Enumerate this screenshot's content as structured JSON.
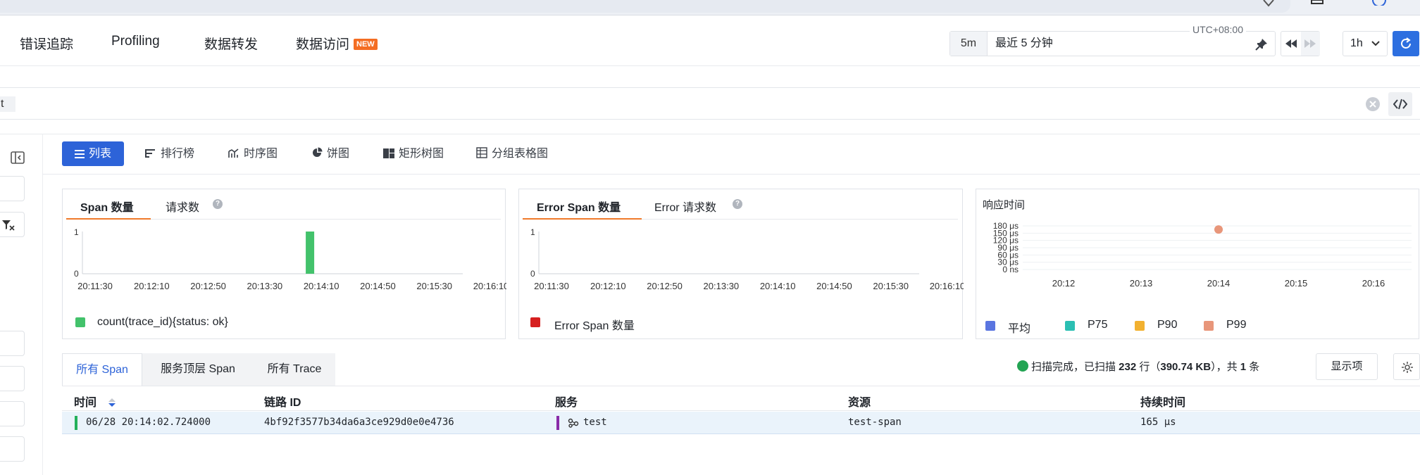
{
  "nav": {
    "items": [
      {
        "label": "错误追踪"
      },
      {
        "label": "Profiling"
      },
      {
        "label": "数据转发"
      },
      {
        "label": "数据访问",
        "badge": "NEW"
      }
    ],
    "time": {
      "short": "5m",
      "label": "最近 5 分钟",
      "timezone": "UTC+08:00",
      "interval": "1h"
    }
  },
  "search": {
    "fragment": "t"
  },
  "view_tabs": [
    "列表",
    "排行榜",
    "时序图",
    "饼图",
    "矩形树图",
    "分组表格图"
  ],
  "panels": {
    "span_count": {
      "tabs": [
        "Span 数量",
        "请求数"
      ],
      "legend": "count(trace_id){status: ok}",
      "legend_color": "#43c26b"
    },
    "error_count": {
      "tabs": [
        "Error Span 数量",
        "Error 请求数"
      ],
      "legend": "Error Span 数量",
      "legend_color": "#d61f1f"
    },
    "response_time": {
      "title": "响应时间",
      "legend": [
        {
          "name": "平均",
          "color": "#5a75e0"
        },
        {
          "name": "P75",
          "color": "#2bbfb3"
        },
        {
          "name": "P90",
          "color": "#f2b130"
        },
        {
          "name": "P99",
          "color": "#e8967a"
        }
      ]
    }
  },
  "chart_data": [
    {
      "type": "bar",
      "x": [
        "20:11:30",
        "20:12:10",
        "20:12:50",
        "20:13:30",
        "20:14:10",
        "20:14:50",
        "20:15:30",
        "20:16:10"
      ],
      "bars": [
        {
          "x": "20:14:02",
          "value": 1
        }
      ],
      "yticks": [
        "0",
        "1"
      ],
      "ylim": [
        0,
        1
      ],
      "series": [
        {
          "name": "count(trace_id){status: ok}",
          "color": "#43c26b"
        }
      ]
    },
    {
      "type": "bar",
      "x": [
        "20:11:30",
        "20:12:10",
        "20:12:50",
        "20:13:30",
        "20:14:10",
        "20:14:50",
        "20:15:30",
        "20:16:10"
      ],
      "bars": [],
      "yticks": [
        "0",
        "1"
      ],
      "ylim": [
        0,
        1
      ],
      "series": [
        {
          "name": "Error Span 数量",
          "color": "#d61f1f"
        }
      ]
    },
    {
      "type": "scatter",
      "title": "响应时间",
      "x": [
        "20:12",
        "20:13",
        "20:14",
        "20:15",
        "20:16"
      ],
      "yticks": [
        "180 μs",
        "150 μs",
        "120 μs",
        "90 μs",
        "60 μs",
        "30 μs",
        "0 ns"
      ],
      "ylim": [
        0,
        180
      ],
      "points": [
        {
          "series": "P99",
          "x": "20:14",
          "y": 165,
          "color": "#e8967a"
        }
      ]
    }
  ],
  "span_tabs": [
    "所有 Span",
    "服务顶层 Span",
    "所有 Trace"
  ],
  "scan": {
    "prefix": "扫描完成，已扫描 ",
    "rows": "232",
    "mid": " 行（",
    "size": "390.74 KB",
    "suffix": "），共 ",
    "count": "1",
    "tail": " 条"
  },
  "display_button": "显示项",
  "table": {
    "columns": [
      "时间",
      "链路 ID",
      "服务",
      "资源",
      "持续时间"
    ],
    "rows": [
      {
        "time": "06/28 20:14:02.724000",
        "trace_id": "4bf92f3577b34da6a3ce929d0e0e4736",
        "service": "test",
        "resource": "test-span",
        "duration": "165 μs"
      }
    ]
  }
}
